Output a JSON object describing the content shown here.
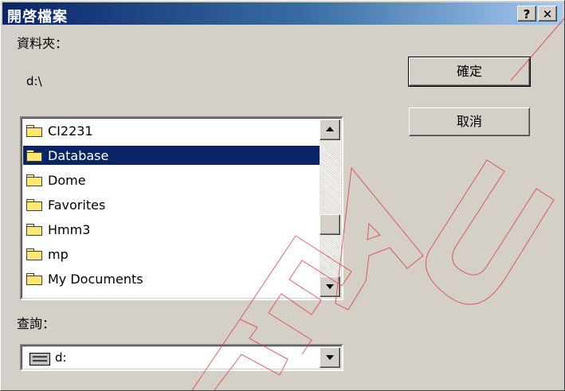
{
  "dialog": {
    "title": "開啓檔案",
    "help_button": "?",
    "close_button": "✕"
  },
  "folders_label": "資料夾：",
  "current_path": "d:\\",
  "folder_list": [
    {
      "name": "CI2231",
      "selected": false
    },
    {
      "name": "Database",
      "selected": true
    },
    {
      "name": "Dome",
      "selected": false
    },
    {
      "name": "Favorites",
      "selected": false
    },
    {
      "name": "Hmm3",
      "selected": false
    },
    {
      "name": "mp",
      "selected": false
    },
    {
      "name": "My Documents",
      "selected": false
    }
  ],
  "drive_label": "查詢：",
  "drive_value": "d:",
  "buttons": {
    "ok": "確定",
    "cancel": "取消"
  },
  "watermark_text": "TEAU"
}
